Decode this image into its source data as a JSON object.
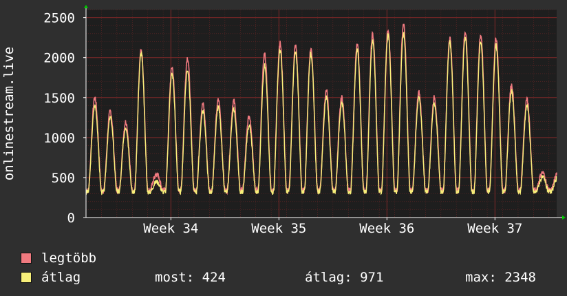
{
  "colors": {
    "background": "#2f2f2f",
    "plot_bg": "#1e1e1e",
    "grid": "#8a2a2a",
    "axis": "#ffffff",
    "arrow": "#00cc00",
    "max_series": "#f07a80",
    "avg_series": "#f8f07a"
  },
  "legend": {
    "max_label": "legtöbb",
    "avg_label": "átlag"
  },
  "stats": {
    "now": "most: 424",
    "avg": "átlag: 971",
    "max": "max: 2348"
  },
  "chart_data": {
    "type": "line",
    "ylabel": "onlinestream.live",
    "xlabel": "",
    "ylim": [
      0,
      2600
    ],
    "yticks": [
      0,
      500,
      1000,
      1500,
      2000,
      2500
    ],
    "xtick_labels": [
      "Week 34",
      "Week 35",
      "Week 36",
      "Week 37"
    ],
    "xtick_days": [
      5.5,
      12.5,
      19.5,
      26.5
    ],
    "x_unit": "days",
    "x_range": [
      0,
      30.5
    ],
    "grid": true,
    "legend_position": "bottom-left",
    "daily_peaks_avg": [
      1400,
      1250,
      1130,
      2050,
      450,
      1800,
      1850,
      1330,
      1380,
      1350,
      1150,
      1900,
      2100,
      2080,
      2050,
      1500,
      1440,
      2100,
      2200,
      2280,
      2300,
      1500,
      1430,
      2200,
      2250,
      2200,
      2150,
      1580,
      1400,
      500
    ],
    "daily_peaks_max": [
      1500,
      1330,
      1200,
      2080,
      550,
      1880,
      2000,
      1420,
      1470,
      1460,
      1270,
      2040,
      2180,
      2150,
      2110,
      1590,
      1500,
      2160,
      2290,
      2360,
      2420,
      1560,
      1500,
      2250,
      2330,
      2290,
      2240,
      1660,
      1480,
      560
    ],
    "series": [
      {
        "name": "legtöbb",
        "color": "#f07a80"
      },
      {
        "name": "átlag",
        "color": "#f8f07a"
      }
    ]
  }
}
